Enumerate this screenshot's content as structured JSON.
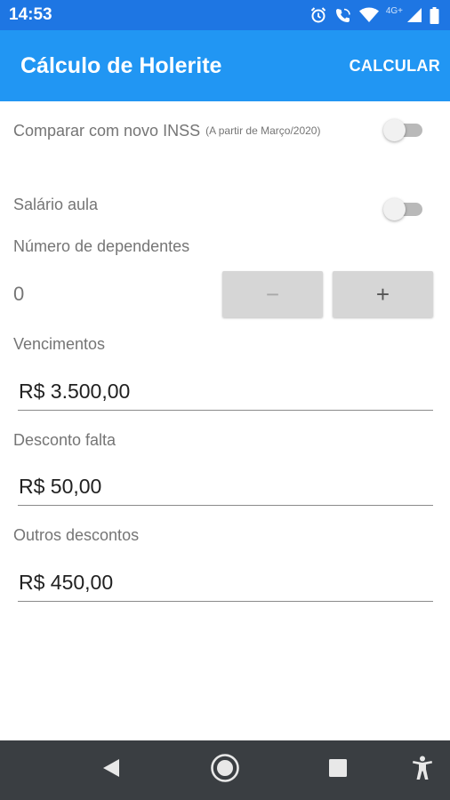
{
  "status_bar": {
    "time": "14:53",
    "network_label": "4G+",
    "icons": [
      "alarm-icon",
      "wifi-call-icon",
      "wifi-icon",
      "signal-icon",
      "battery-icon"
    ]
  },
  "app_bar": {
    "title": "Cálculo de Holerite",
    "action": "CALCULAR",
    "color": "#2196f3"
  },
  "form": {
    "compare_inss": {
      "label": "Comparar com novo INSS",
      "note": "(A partir de Março/2020)",
      "enabled": false
    },
    "salario_aula": {
      "label": "Salário aula",
      "enabled": false
    },
    "dependentes": {
      "label": "Número de dependentes",
      "value": "0",
      "minus": "−",
      "plus": "+"
    },
    "vencimentos": {
      "label": "Vencimentos",
      "value": "R$ 3.500,00"
    },
    "desconto_falta": {
      "label": "Desconto falta",
      "value": "R$ 50,00"
    },
    "outros_descontos": {
      "label": "Outros descontos",
      "value": "R$ 450,00"
    }
  },
  "nav_bar": {
    "icons": [
      "back-icon",
      "home-icon",
      "recents-icon",
      "accessibility-icon"
    ]
  }
}
